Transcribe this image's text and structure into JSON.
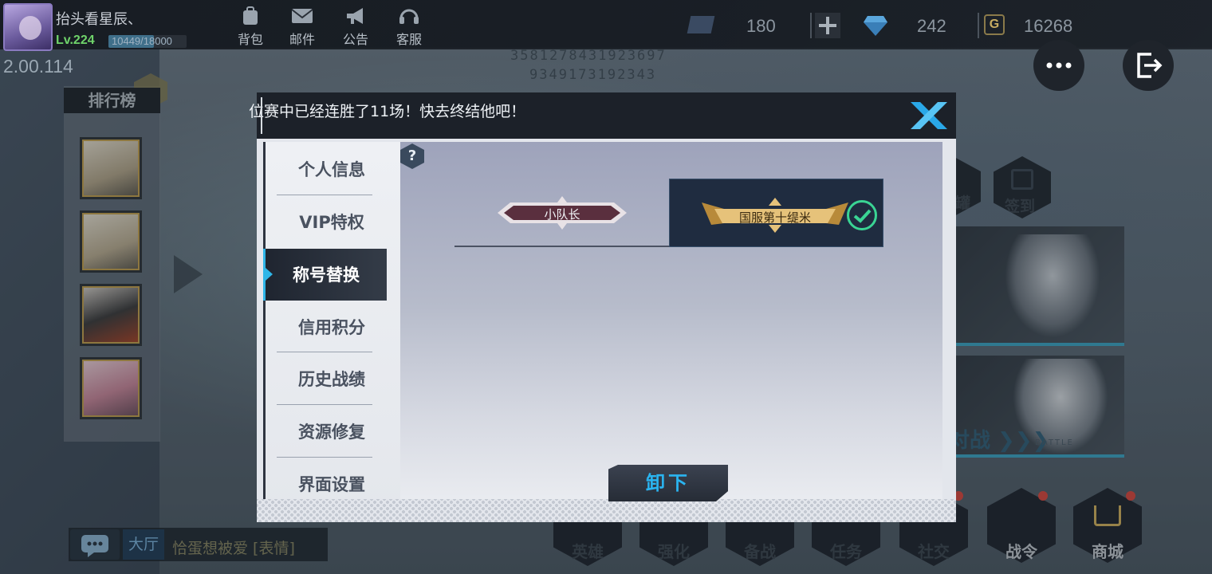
{
  "player": {
    "name": "抬头看星辰、",
    "level": "Lv.224",
    "exp_text": "10449/18000",
    "exp_fraction": 0.58
  },
  "version": "2.00.114",
  "top_nav": [
    {
      "label": "背包",
      "icon": "backpack-icon"
    },
    {
      "label": "邮件",
      "icon": "mail-icon"
    },
    {
      "label": "公告",
      "icon": "megaphone-icon"
    },
    {
      "label": "客服",
      "icon": "headset-icon"
    }
  ],
  "resources": {
    "ticket": "180",
    "diamond": "242",
    "gold": "16268"
  },
  "leaderboard": {
    "title": "排行榜"
  },
  "chat": {
    "channel": "大厅",
    "message": "恰蛋想被爱 [表情]"
  },
  "background_code": [
    "3581278431923697",
    "9349173192343"
  ],
  "side_buttons": {
    "shop_partial": "罐",
    "sign_in": "签到"
  },
  "banner": {
    "battle_text": "对战 ❯❯❯",
    "battle_sub": "BATTLE"
  },
  "bottom_nav": [
    "英雄",
    "强化",
    "备战",
    "任务",
    "社交",
    "战令",
    "商城"
  ],
  "modal": {
    "marquee": "位赛中已经连胜了11场！快去终结他吧！",
    "tabs": [
      "个人信息",
      "VIP特权",
      "称号替换",
      "信用积分",
      "历史战绩",
      "资源修复",
      "界面设置"
    ],
    "active_tab_index": 2,
    "help": "?",
    "titles": [
      {
        "text": "小队长",
        "selected": false
      },
      {
        "text": "国服第十缇米",
        "selected": true
      }
    ],
    "unequip_label": "卸下"
  },
  "colors": {
    "accent_blue": "#2fb6e8",
    "check_green": "#3ad494",
    "level_green": "#6fd36a",
    "gold": "#d9b45a"
  }
}
